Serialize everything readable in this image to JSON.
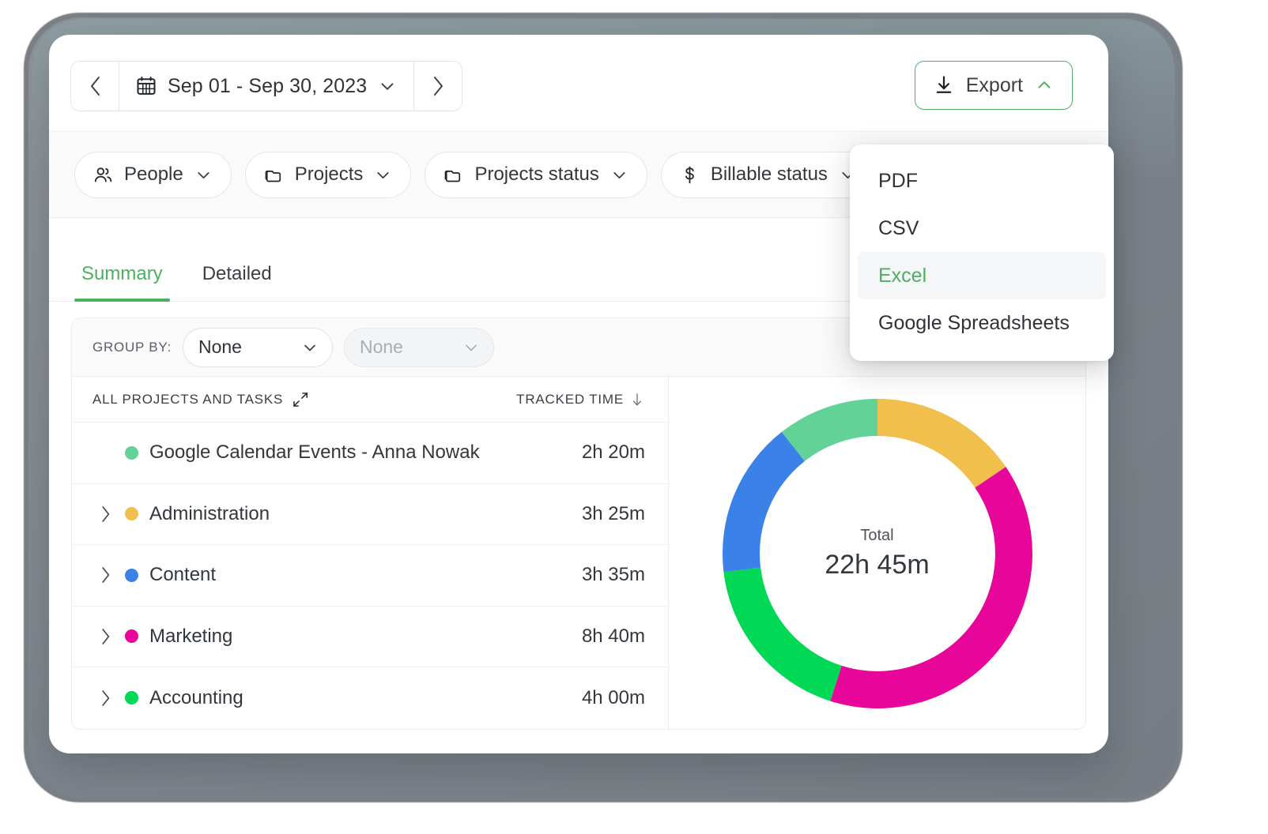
{
  "toolbar": {
    "prev_label": "‹",
    "next_label": "›",
    "date_range": "Sep 01 - Sep 30, 2023",
    "export_label": "Export"
  },
  "export_menu": {
    "items": [
      {
        "label": "PDF",
        "active": false
      },
      {
        "label": "CSV",
        "active": false
      },
      {
        "label": "Excel",
        "active": true
      },
      {
        "label": "Google Spreadsheets",
        "active": false
      }
    ]
  },
  "filters": [
    {
      "label": "People",
      "icon": "people-icon"
    },
    {
      "label": "Projects",
      "icon": "folder-icon"
    },
    {
      "label": "Projects status",
      "icon": "folder-icon"
    },
    {
      "label": "Billable status",
      "icon": "dollar-icon"
    }
  ],
  "tabs": [
    {
      "label": "Summary",
      "active": true
    },
    {
      "label": "Detailed",
      "active": false
    }
  ],
  "group_by": {
    "label": "GROUP BY:",
    "primary_value": "None",
    "secondary_value": "None"
  },
  "table": {
    "col_projects": "ALL PROJECTS AND TASKS",
    "col_time": "TRACKED TIME",
    "rows": [
      {
        "name": "Google Calendar Events - Anna Nowak",
        "time": "2h 20m",
        "color": "#63d297",
        "expandable": false
      },
      {
        "name": "Administration",
        "time": "3h 25m",
        "color": "#f0bf4c",
        "expandable": true
      },
      {
        "name": "Content",
        "time": "3h 35m",
        "color": "#3b82e8",
        "expandable": true
      },
      {
        "name": "Marketing",
        "time": "8h 40m",
        "color": "#e8069a",
        "expandable": true
      },
      {
        "name": "Accounting",
        "time": "4h 00m",
        "color": "#00d856",
        "expandable": true
      }
    ]
  },
  "chart_data": {
    "type": "pie",
    "title": "",
    "center_label": "Total",
    "center_value": "22h 45m",
    "total_hours": 22.75,
    "legend": "inline-with-table",
    "categories": [
      "Administration",
      "Marketing",
      "Accounting",
      "Content",
      "Google Calendar Events - Anna Nowak"
    ],
    "values": [
      3.4167,
      8.6667,
      4.0,
      3.5833,
      2.3333
    ],
    "labels": [
      "3h 25m",
      "8h 40m",
      "4h 00m",
      "3h 35m",
      "2h 20m"
    ],
    "colors": [
      "#f0bf4c",
      "#e8069a",
      "#00d856",
      "#3b82e8",
      "#63d297"
    ],
    "start_angle_deg": 0,
    "donut_hole_ratio": 0.76
  },
  "theme": {
    "accent": "#4caf62",
    "text": "#32373c",
    "muted": "#8a9096"
  }
}
